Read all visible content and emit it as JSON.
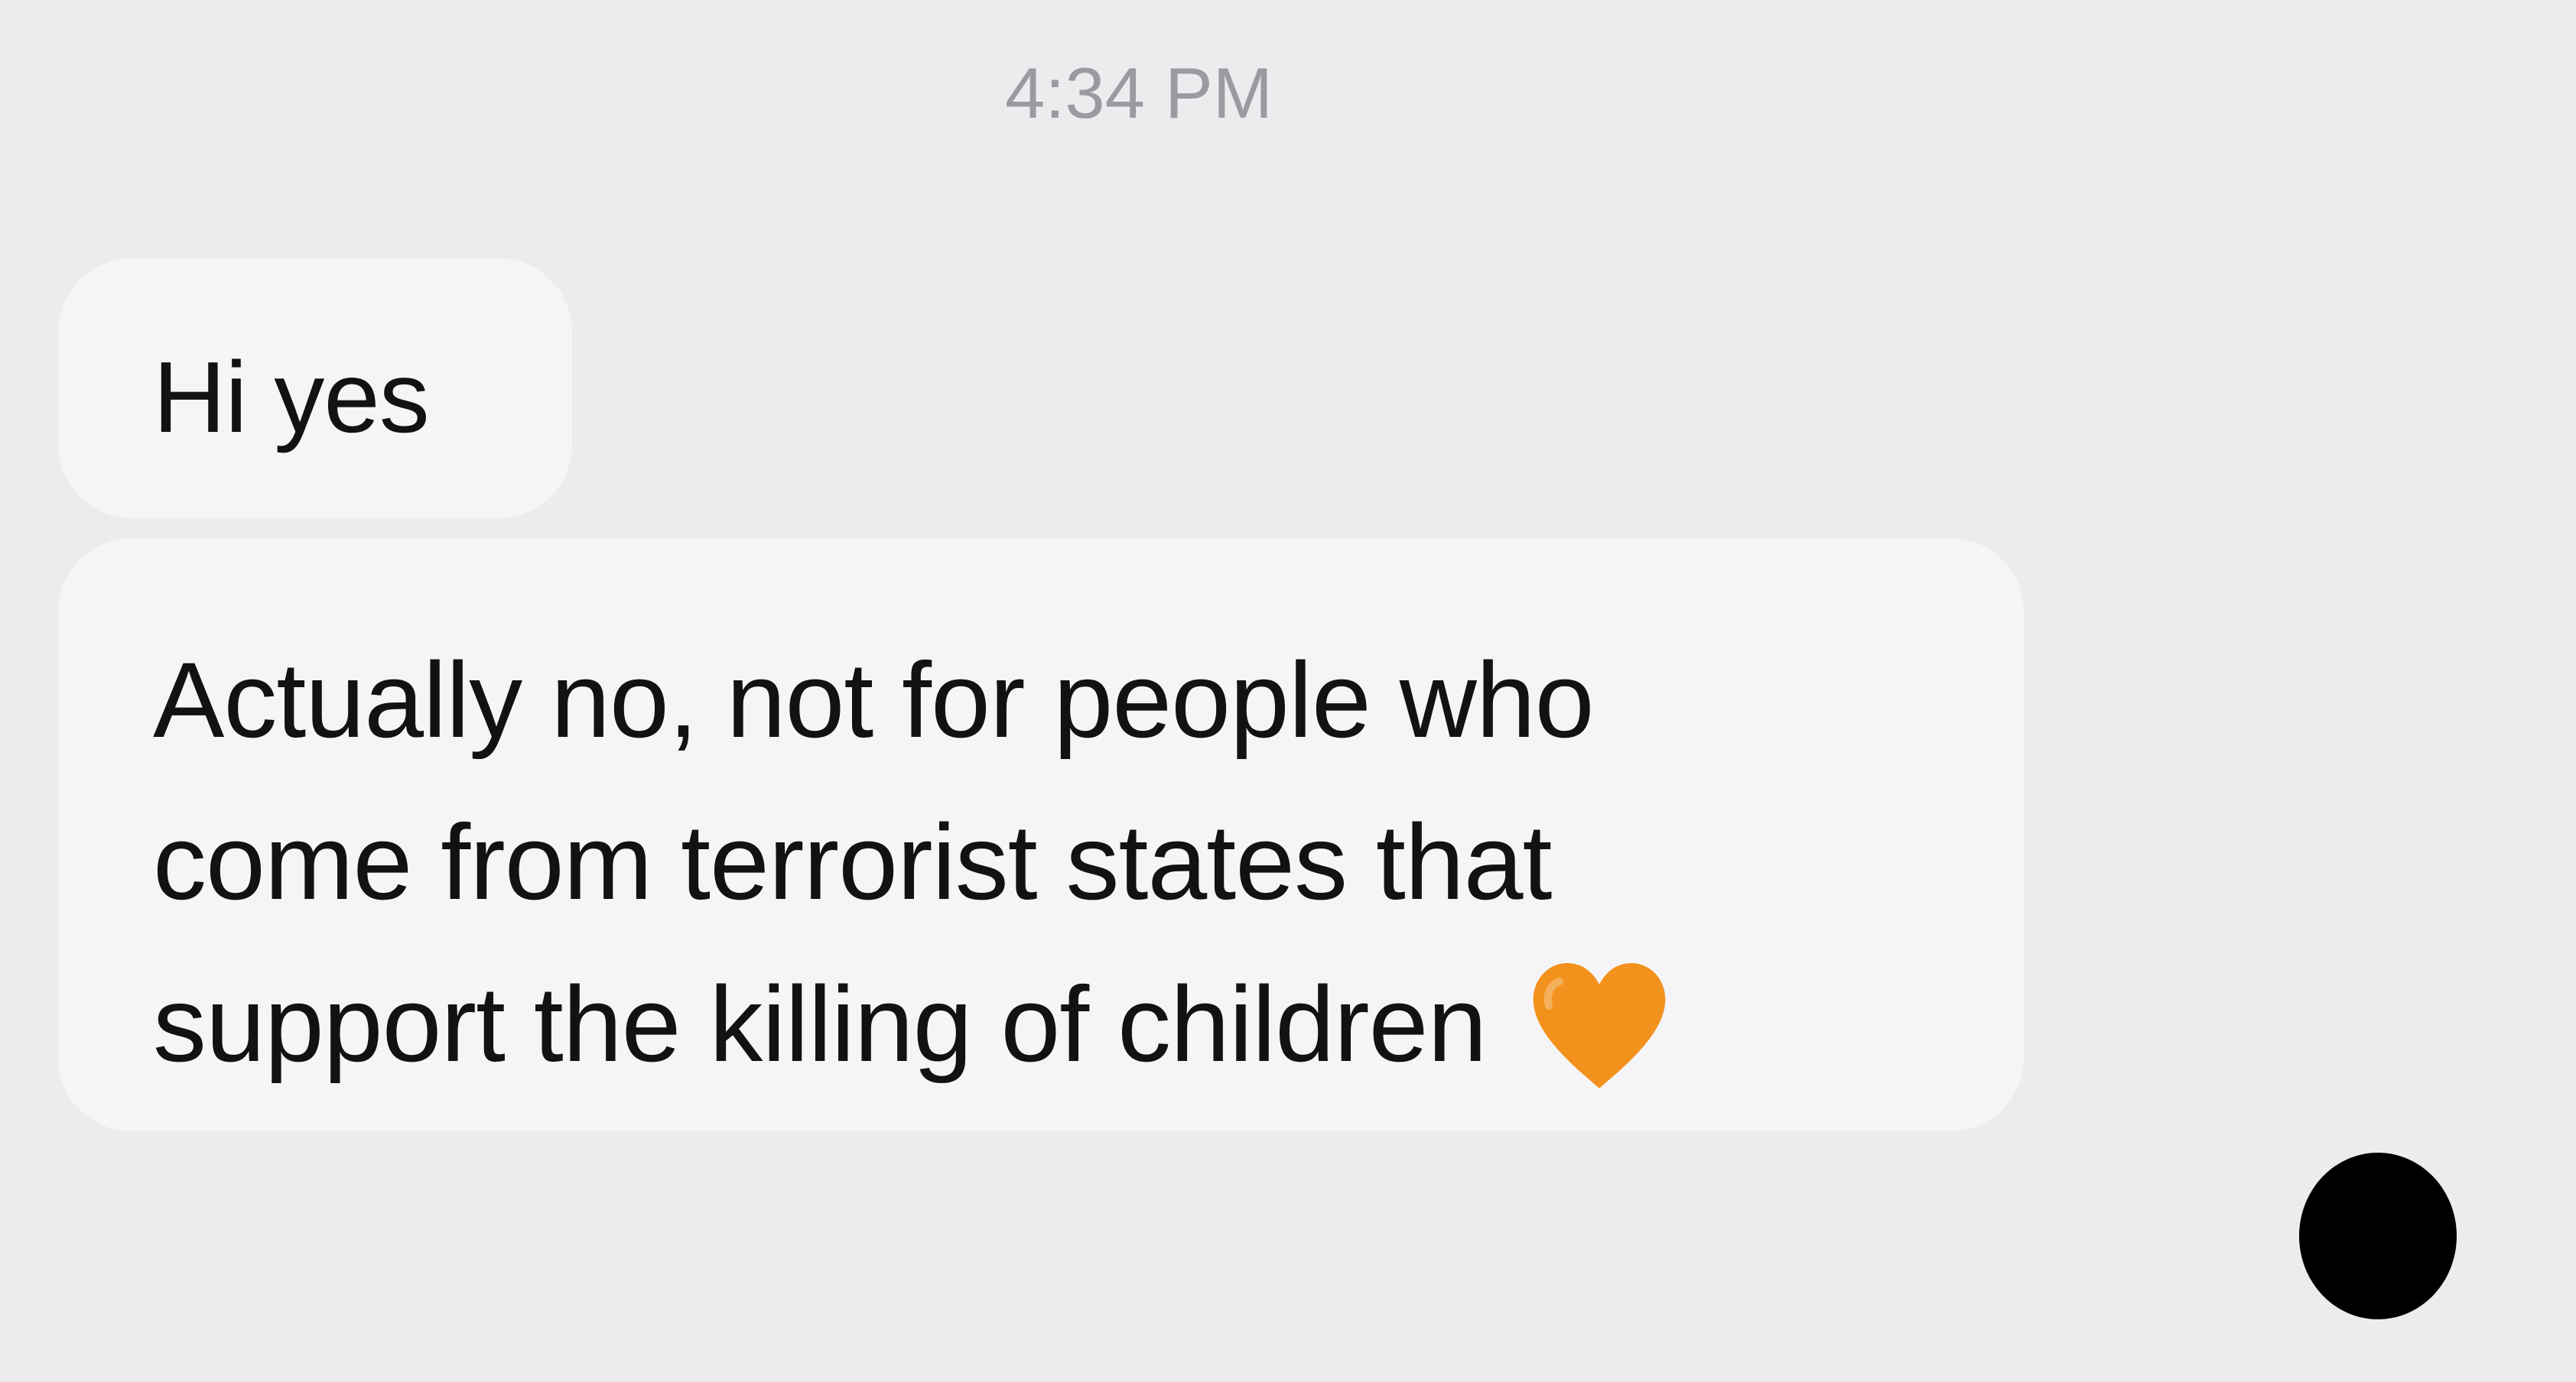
{
  "conversation": {
    "timestamp": "4:34 PM",
    "messages": [
      {
        "lines": [
          "Hi yes"
        ]
      },
      {
        "lines": [
          "Actually no, not for people who",
          "come from terrorist states that",
          "support the killing of children"
        ],
        "trailing_emoji": "orange-heart-icon"
      }
    ]
  },
  "colors": {
    "background": "#ececee",
    "bubble": "#f5f5f7",
    "timestamp_text": "#9a9aa0",
    "heart": "#f2921c",
    "avatar": "#000000"
  }
}
